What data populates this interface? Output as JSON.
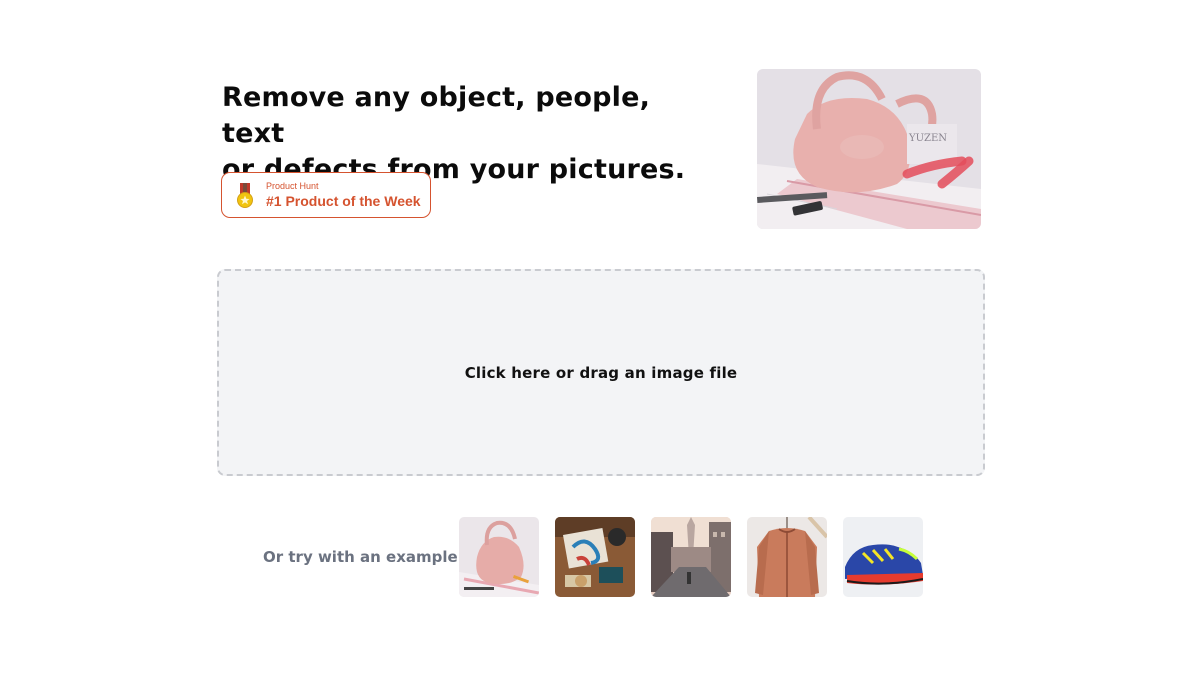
{
  "headline": {
    "line1": "Remove any object, people, text",
    "line2": "or defects from your pictures."
  },
  "badge": {
    "small_label": "Product Hunt",
    "main_label": "#1 Product of the Week",
    "icon": "medal-icon",
    "accent_color": "#d5532f"
  },
  "hero_image": {
    "subject": "pink handbag with red object-removal brush stroke"
  },
  "dropzone": {
    "label": "Click here or drag an image file"
  },
  "examples": {
    "label": "Or try with an example",
    "items": [
      {
        "subject": "pink-handbag"
      },
      {
        "subject": "desk-flatlay"
      },
      {
        "subject": "paris-street"
      },
      {
        "subject": "orange-jacket"
      },
      {
        "subject": "blue-sneaker"
      }
    ]
  }
}
